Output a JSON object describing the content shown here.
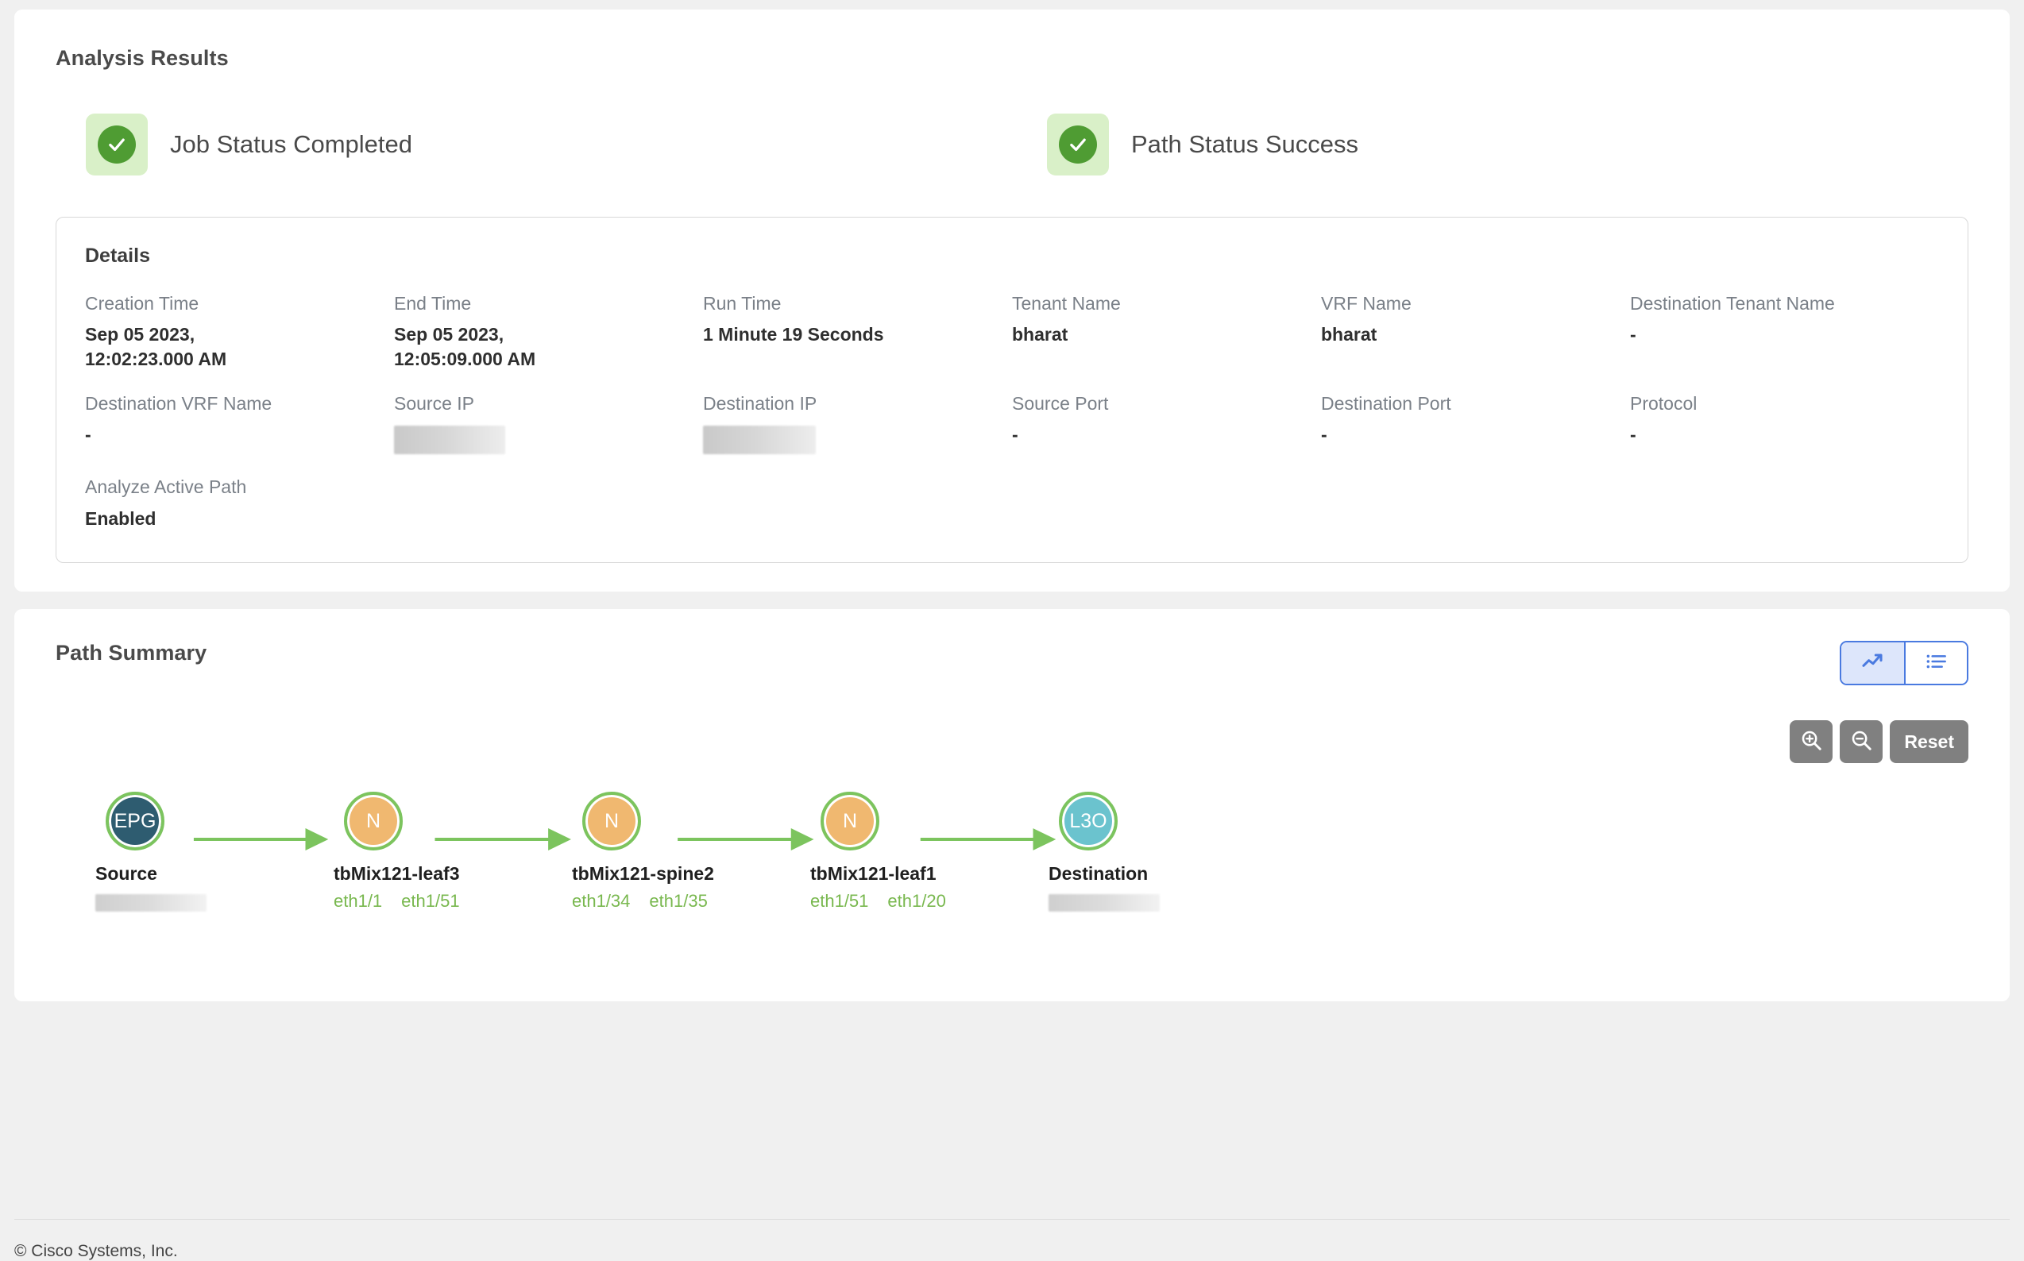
{
  "analysis": {
    "title": "Analysis Results",
    "statuses": [
      {
        "icon": "check-circle-icon",
        "label": "Job Status Completed"
      },
      {
        "icon": "check-circle-icon",
        "label": "Path Status Success"
      }
    ],
    "details": {
      "heading": "Details",
      "fields": [
        {
          "label": "Creation Time",
          "value": "Sep 05 2023,\n12:02:23.000 AM",
          "redacted": false
        },
        {
          "label": "End Time",
          "value": "Sep 05 2023,\n12:05:09.000 AM",
          "redacted": false
        },
        {
          "label": "Run Time",
          "value": "1 Minute 19 Seconds",
          "redacted": false
        },
        {
          "label": "Tenant Name",
          "value": "bharat",
          "redacted": false
        },
        {
          "label": "VRF Name",
          "value": "bharat",
          "redacted": false
        },
        {
          "label": "Destination Tenant Name",
          "value": "-",
          "redacted": false
        },
        {
          "label": "Destination VRF Name",
          "value": "-",
          "redacted": false
        },
        {
          "label": "Source IP",
          "value": "",
          "redacted": true
        },
        {
          "label": "Destination IP",
          "value": "",
          "redacted": true
        },
        {
          "label": "Source Port",
          "value": "-",
          "redacted": false
        },
        {
          "label": "Destination Port",
          "value": "-",
          "redacted": false
        },
        {
          "label": "Protocol",
          "value": "-",
          "redacted": false
        },
        {
          "label": "Analyze Active Path",
          "value": "Enabled",
          "redacted": false
        }
      ]
    }
  },
  "path_summary": {
    "title": "Path Summary",
    "view_toggle": {
      "options": [
        {
          "icon": "trend-chart-icon",
          "active": true
        },
        {
          "icon": "list-icon",
          "active": false
        }
      ]
    },
    "controls": [
      {
        "name": "zoom-in",
        "icon": "zoom-in-icon",
        "label": ""
      },
      {
        "name": "zoom-out",
        "icon": "zoom-out-icon",
        "label": ""
      },
      {
        "name": "reset",
        "icon": "",
        "label": "Reset"
      }
    ],
    "topology": {
      "nodes": [
        {
          "badge": "EPG",
          "type": "epg",
          "name": "Source",
          "ifaces": [],
          "redacted": true
        },
        {
          "badge": "N",
          "type": "n",
          "name": "tbMix121-leaf3",
          "ifaces": [
            "eth1/1",
            "eth1/51"
          ],
          "redacted": false
        },
        {
          "badge": "N",
          "type": "n",
          "name": "tbMix121-spine2",
          "ifaces": [
            "eth1/34",
            "eth1/35"
          ],
          "redacted": false
        },
        {
          "badge": "N",
          "type": "n",
          "name": "tbMix121-leaf1",
          "ifaces": [
            "eth1/51",
            "eth1/20"
          ],
          "redacted": false
        },
        {
          "badge": "L3O",
          "type": "l3o",
          "name": "Destination",
          "ifaces": [],
          "redacted": true
        }
      ]
    }
  },
  "footer": {
    "copyright": "© Cisco Systems, Inc."
  },
  "colors": {
    "page_background": "#f0f0f0",
    "card_background": "#ffffff",
    "status_chip_background": "#d9f0c8",
    "status_check_green": "#4f9c33",
    "link_green": "#7cc45e",
    "iface_green": "#79b84f",
    "node_epg": "#2e5c70",
    "node_n": "#f0b870",
    "node_l3o": "#6bc3ce",
    "toggle_border": "#4a7ae0",
    "toggle_active_background": "#dde6fb",
    "control_gray": "#808080",
    "label_gray": "#7a8088",
    "value_dark": "#2f2f2f"
  }
}
